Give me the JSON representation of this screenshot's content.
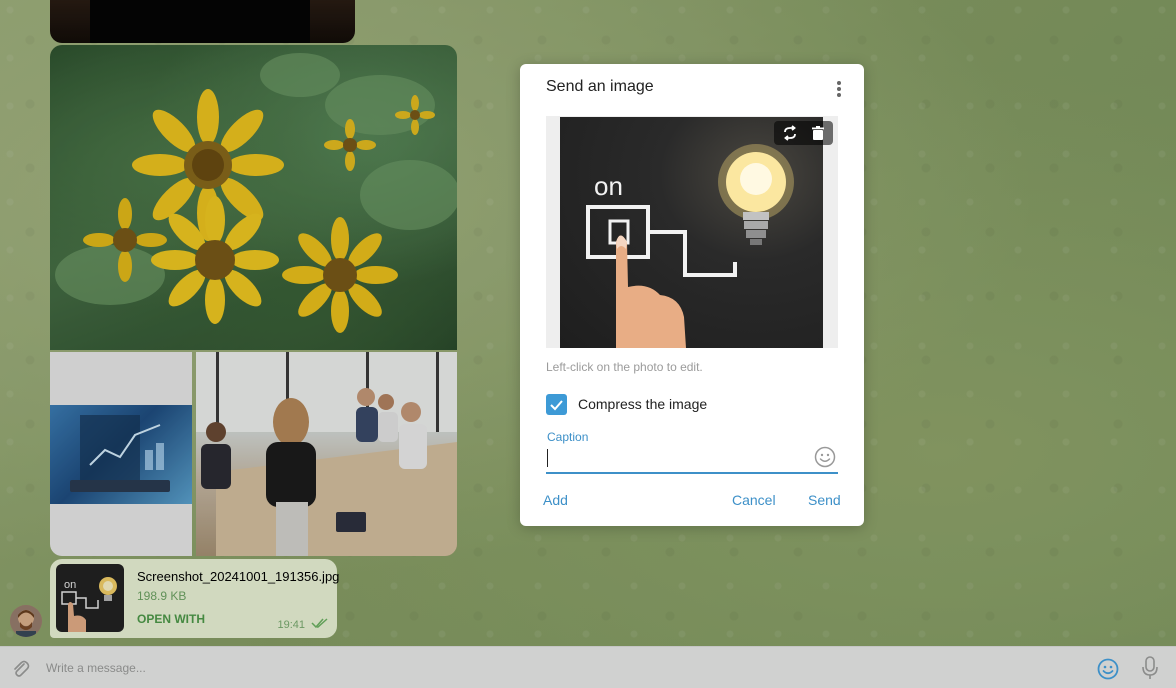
{
  "file": {
    "name": "Screenshot_20241001_191356.jpg",
    "size": "198.9 KB",
    "open_with": "OPEN WITH",
    "time": "19:41"
  },
  "input": {
    "placeholder": "Write a message..."
  },
  "dialog": {
    "title": "Send an image",
    "hint": "Left-click on the photo to edit.",
    "compress_label": "Compress the image",
    "compress_checked": true,
    "caption_label": "Caption",
    "caption_value": "",
    "add_label": "Add",
    "cancel_label": "Cancel",
    "send_label": "Send",
    "preview_text": "on"
  },
  "colors": {
    "accent": "#3d90c8",
    "file_green": "#4f9d4a",
    "bubble": "#eef7da"
  },
  "icons": {
    "menu": "more-vertical-icon",
    "replace": "replace-icon",
    "delete": "trash-icon",
    "attach": "paperclip-icon",
    "emoji": "smile-icon",
    "mic": "microphone-icon",
    "check": "double-check-icon"
  }
}
